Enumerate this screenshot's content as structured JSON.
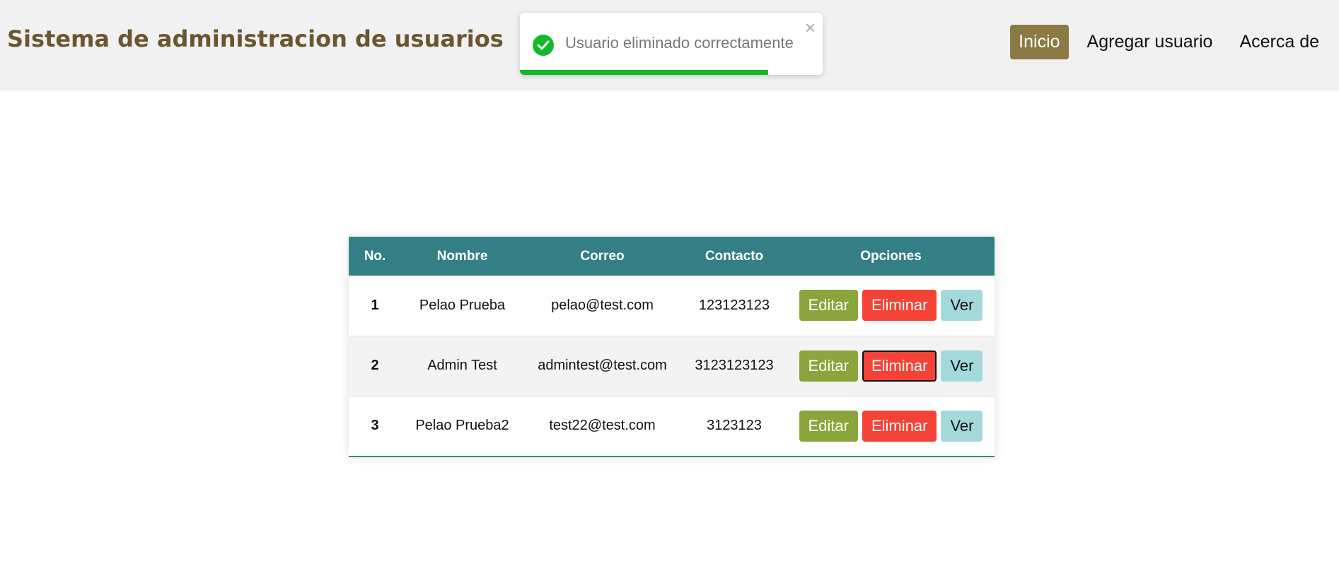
{
  "header": {
    "title": "Sistema de administracion de usuarios",
    "nav": [
      {
        "label": "Inicio",
        "active": true
      },
      {
        "label": "Agregar usuario",
        "active": false
      },
      {
        "label": "Acerca de",
        "active": false
      }
    ]
  },
  "toast": {
    "message": "Usuario eliminado correctamente",
    "close_label": "×",
    "icon": "check-circle-icon",
    "progress": 0.82,
    "color": "#13b92b"
  },
  "table": {
    "headers": [
      "No.",
      "Nombre",
      "Correo",
      "Contacto",
      "Opciones"
    ],
    "rows": [
      {
        "no": "1",
        "nombre": "Pelao Prueba",
        "correo": "pelao@test.com",
        "contacto": "123123123"
      },
      {
        "no": "2",
        "nombre": "Admin Test",
        "correo": "admintest@test.com",
        "contacto": "3123123123"
      },
      {
        "no": "3",
        "nombre": "Pelao Prueba2",
        "correo": "test22@test.com",
        "contacto": "3123123"
      }
    ],
    "actions": {
      "edit": "Editar",
      "delete": "Eliminar",
      "view": "Ver"
    }
  },
  "colors": {
    "brand": "#6a5630",
    "nav_active": "#8b7a45",
    "table_header": "#337f85",
    "edit": "#8aa53b",
    "delete": "#f44336",
    "view": "#a4d9dc"
  }
}
